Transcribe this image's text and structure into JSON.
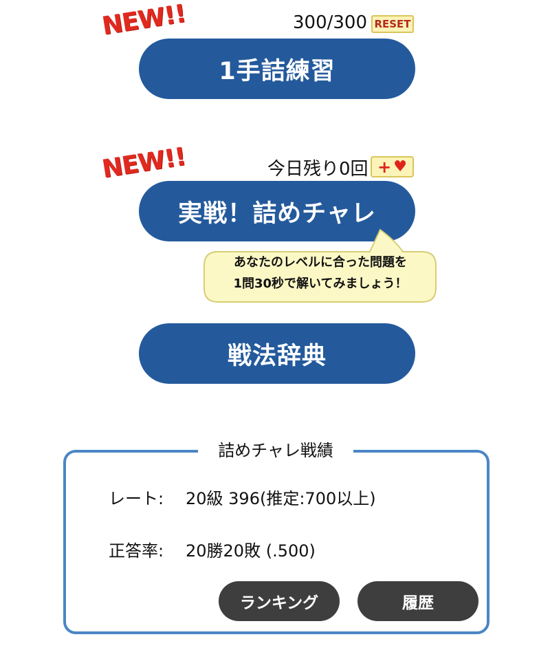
{
  "practice": {
    "badge": "NEW!!",
    "counter": "300/300",
    "reset_label": "RESET",
    "button_label": "1手詰練習"
  },
  "challenge": {
    "badge": "NEW!!",
    "remaining": "今日残り0回",
    "plus_glyph": "+",
    "heart_glyph": "♥",
    "button_label": "実戦！詰めチャレ",
    "tooltip_line1": "あなたのレベルに合った問題を",
    "tooltip_line2": "1問30秒で解いてみましょう！"
  },
  "dictionary": {
    "button_label": "戦法辞典"
  },
  "record": {
    "title": "詰めチャレ戦績",
    "rate_label": "レート:",
    "rate_value": "20級 396(推定:700以上)",
    "accuracy_label": "正答率:",
    "accuracy_value": "20勝20敗 (.500)",
    "ranking_label": "ランキング",
    "history_label": "履歴"
  },
  "colors": {
    "primary_button": "#245a9c",
    "badge_red": "#e02a1f",
    "record_border": "#4a86c5",
    "tooltip_bg": "#fcf8c6",
    "dark_button": "#3e3e3e"
  }
}
